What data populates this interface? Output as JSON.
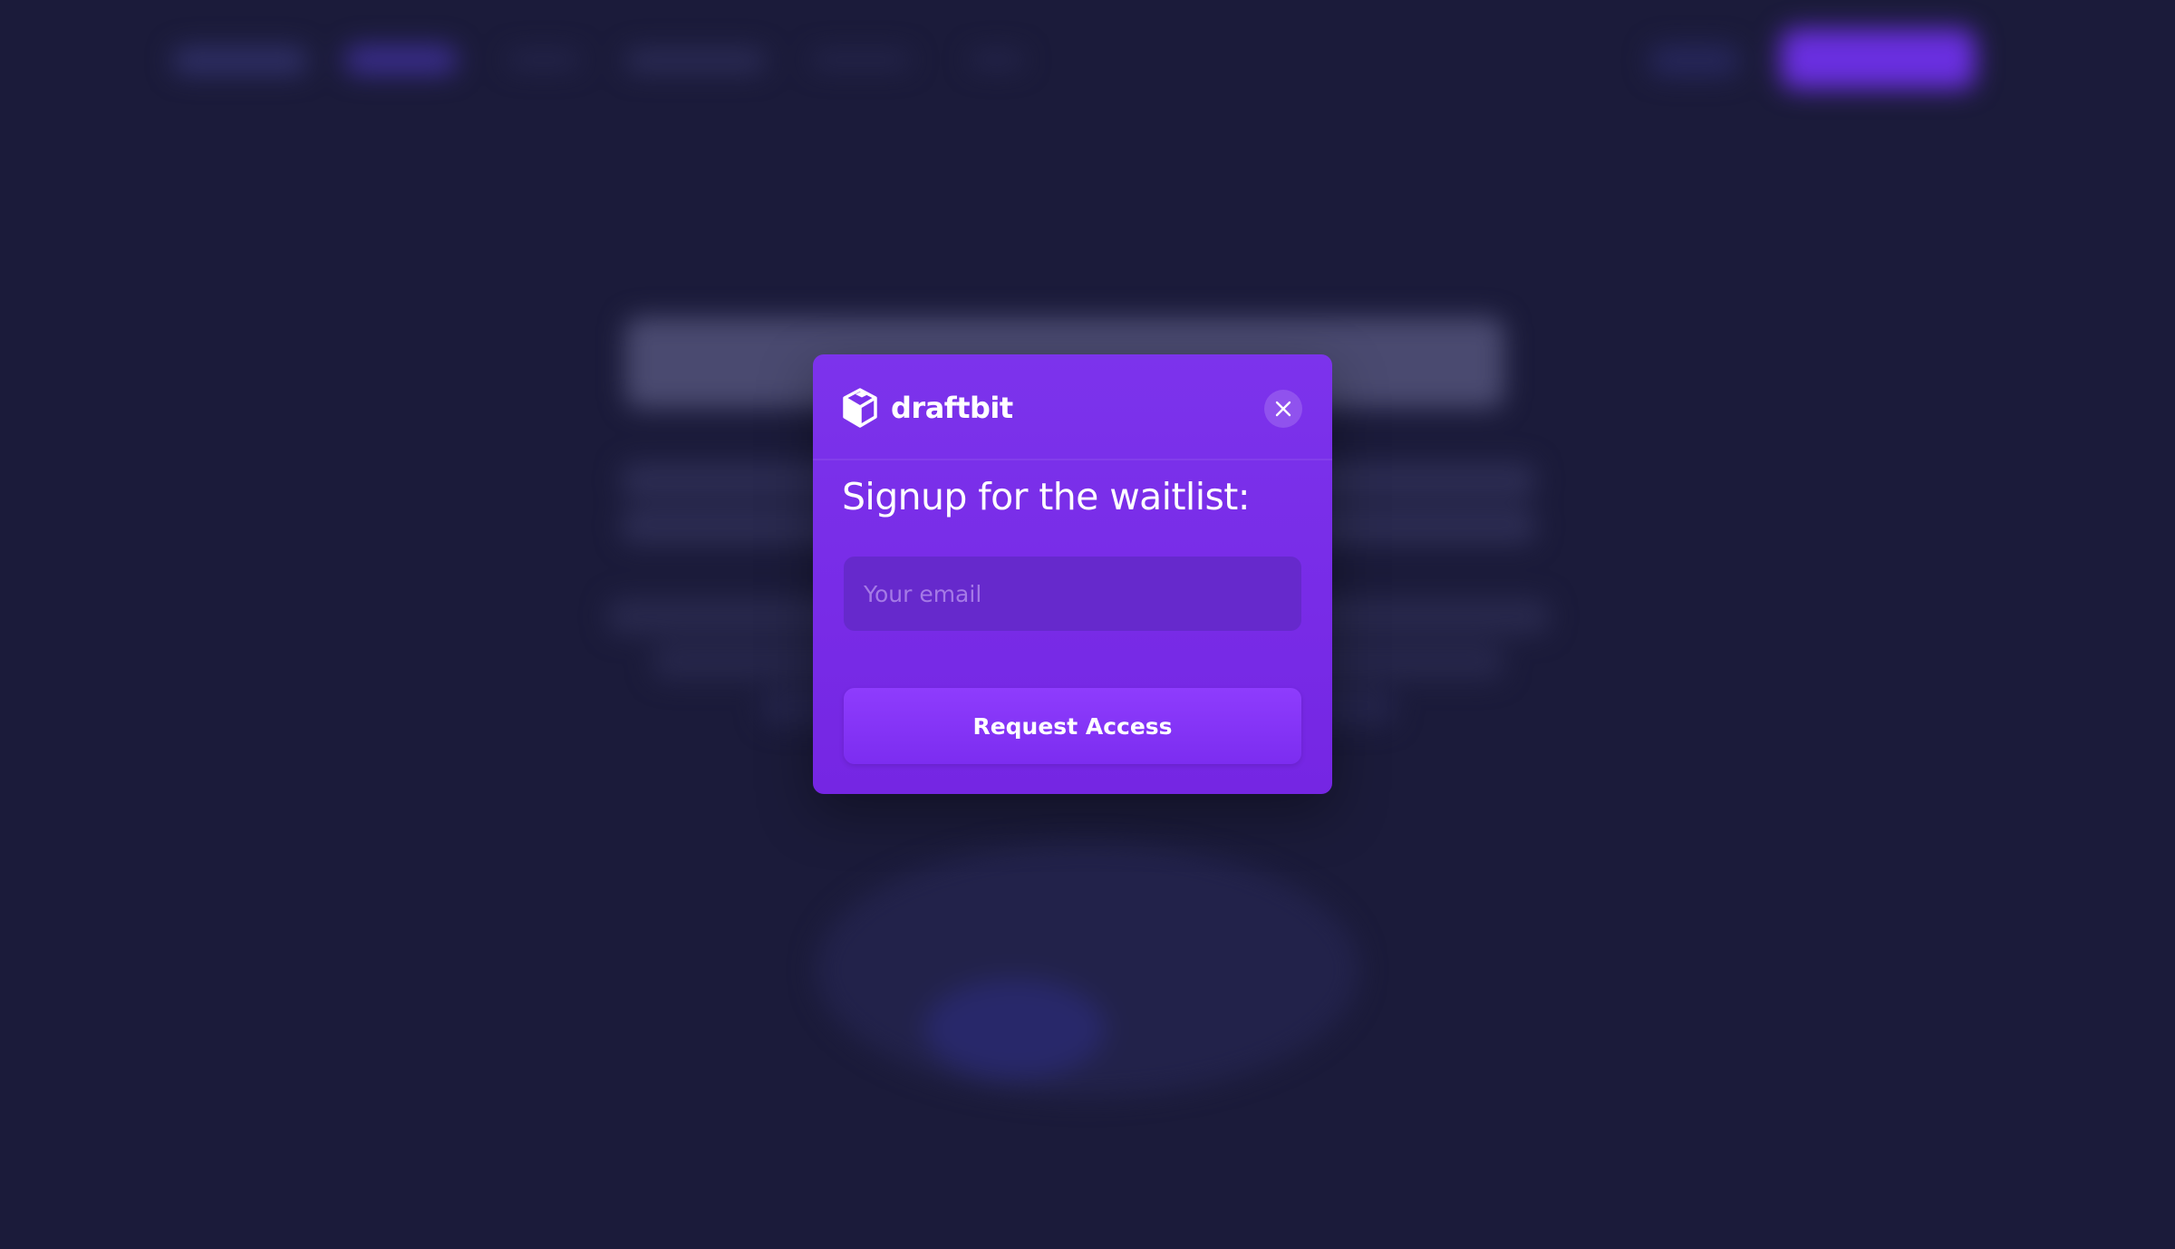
{
  "modal": {
    "brand_name": "draftbit",
    "title": "Signup for the waitlist:",
    "email_placeholder": "Your email",
    "email_value": "",
    "submit_label": "Request Access"
  },
  "icons": {
    "logo": "cube-logo-icon",
    "close": "close-icon"
  },
  "colors": {
    "page_background": "#1b1b3a",
    "modal_background": "#7c33ec",
    "input_background": "#6629cc",
    "button_background": "#8e3cfd",
    "text": "#ffffff"
  }
}
